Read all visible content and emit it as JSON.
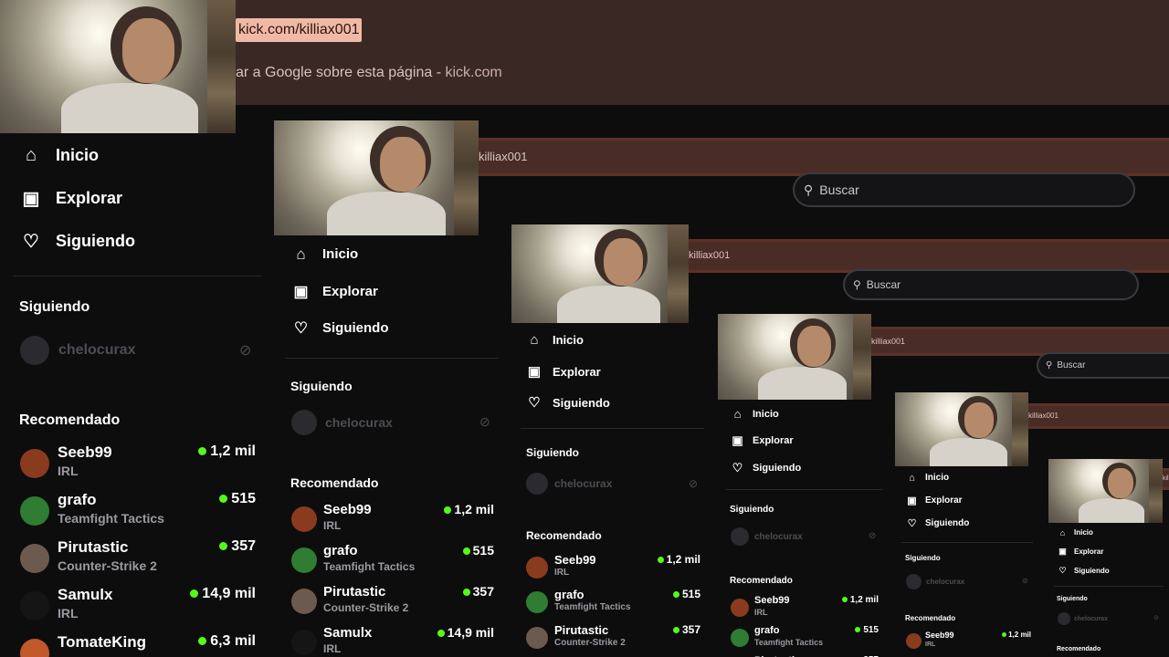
{
  "browser": {
    "url": "kick.com/killiax001",
    "url_partial": "killiax001",
    "google_hint_prefix": "ar a Google sobre esta página - ",
    "google_hint_domain": "kick.com"
  },
  "search": {
    "placeholder": "Buscar"
  },
  "nav": [
    {
      "label": "Inicio",
      "icon": "home-icon"
    },
    {
      "label": "Explorar",
      "icon": "explore-icon"
    },
    {
      "label": "Siguiendo",
      "icon": "heart-icon"
    }
  ],
  "following": {
    "title": "Siguiendo",
    "channel": "chelocurax"
  },
  "recommended": {
    "title": "Recomendado",
    "items": [
      {
        "name": "Seeb99",
        "category": "IRL",
        "viewers": "1,2 mil"
      },
      {
        "name": "grafo",
        "category": "Teamfight Tactics",
        "viewers": "515"
      },
      {
        "name": "Pirutastic",
        "category": "Counter-Strike 2",
        "viewers": "357"
      },
      {
        "name": "Samulx",
        "category": "IRL",
        "viewers": "14,9 mil"
      },
      {
        "name": "TomateKing",
        "category": "",
        "viewers": "6,3 mil"
      }
    ]
  },
  "colors": {
    "accent": "#53fc18",
    "url_highlight": "#f0b9a6",
    "browser_bar": "#3a2824"
  }
}
